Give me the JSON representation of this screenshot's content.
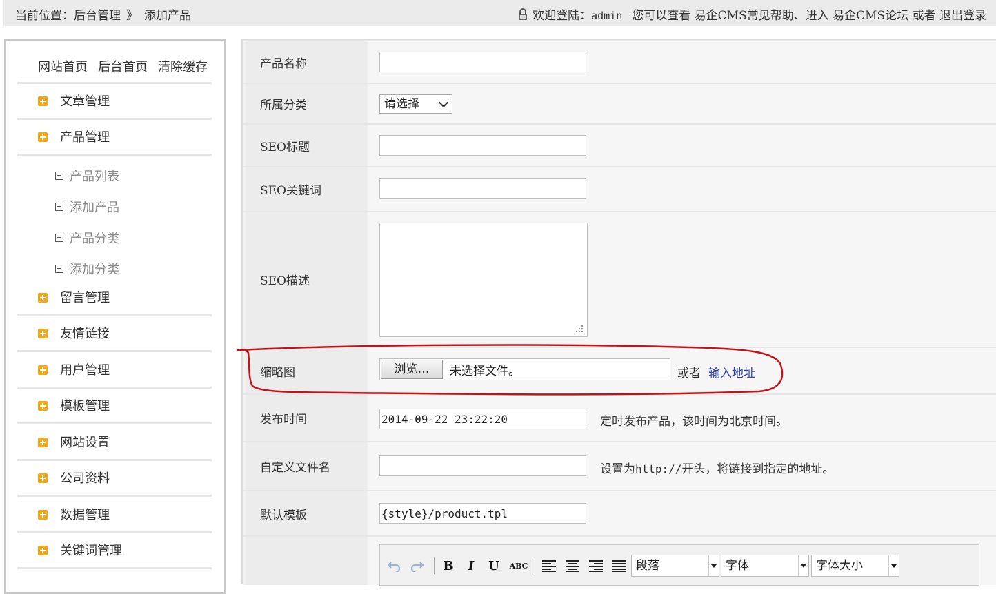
{
  "topbar": {
    "location_label": "当前位置：",
    "crumb_1": "后台管理",
    "crumb_sep": "》",
    "crumb_2": "添加产品",
    "welcome_label": "欢迎登陆：",
    "username": "admin",
    "help_prefix": "您可以查看",
    "help_link": "易企CMS常见帮助",
    "enter_text": "、进入",
    "forum_link": "易企CMS论坛",
    "or_text": "或者",
    "logout_link": "退出登录"
  },
  "sidebar": {
    "quick_links": [
      "网站首页",
      "后台首页",
      "清除缓存"
    ],
    "menu": [
      {
        "label": "文章管理"
      },
      {
        "label": "产品管理"
      },
      {
        "label": "留言管理"
      },
      {
        "label": "友情链接"
      },
      {
        "label": "用户管理"
      },
      {
        "label": "模板管理"
      },
      {
        "label": "网站设置"
      },
      {
        "label": "公司资料"
      },
      {
        "label": "数据管理"
      },
      {
        "label": "关键词管理"
      }
    ],
    "product_submenu": [
      "产品列表",
      "添加产品",
      "产品分类",
      "添加分类"
    ]
  },
  "form": {
    "product_name": {
      "label": "产品名称",
      "value": ""
    },
    "category": {
      "label": "所属分类",
      "selected": "请选择"
    },
    "seo_title": {
      "label": "SEO标题",
      "value": ""
    },
    "seo_keywords": {
      "label": "SEO关键词",
      "value": ""
    },
    "seo_desc": {
      "label": "SEO描述",
      "value": ""
    },
    "thumbnail": {
      "label": "缩略图",
      "browse": "浏览…",
      "no_file": "未选择文件。",
      "or": "或者",
      "url_link": "输入地址"
    },
    "publish_time": {
      "label": "发布时间",
      "value": "2014-09-22 23:22:20",
      "hint": "定时发布产品，该时间为北京时间。"
    },
    "custom_filename": {
      "label": "自定义文件名",
      "value": "",
      "hint_prefix": "设置为",
      "hint_mono": "http://",
      "hint_suffix": "开头，将链接到指定的地址。"
    },
    "template": {
      "label": "默认模板",
      "value": "{style}/product.tpl"
    }
  },
  "editor": {
    "paragraph": "段落",
    "font": "字体",
    "font_size": "字体大小",
    "bold_glyph": "B",
    "italic_glyph": "I",
    "underline_glyph": "U",
    "strike_glyph": "ABC"
  },
  "colors": {
    "accent_plus": "#f4a814",
    "link": "#3344bb",
    "annotation": "#c0141a"
  }
}
